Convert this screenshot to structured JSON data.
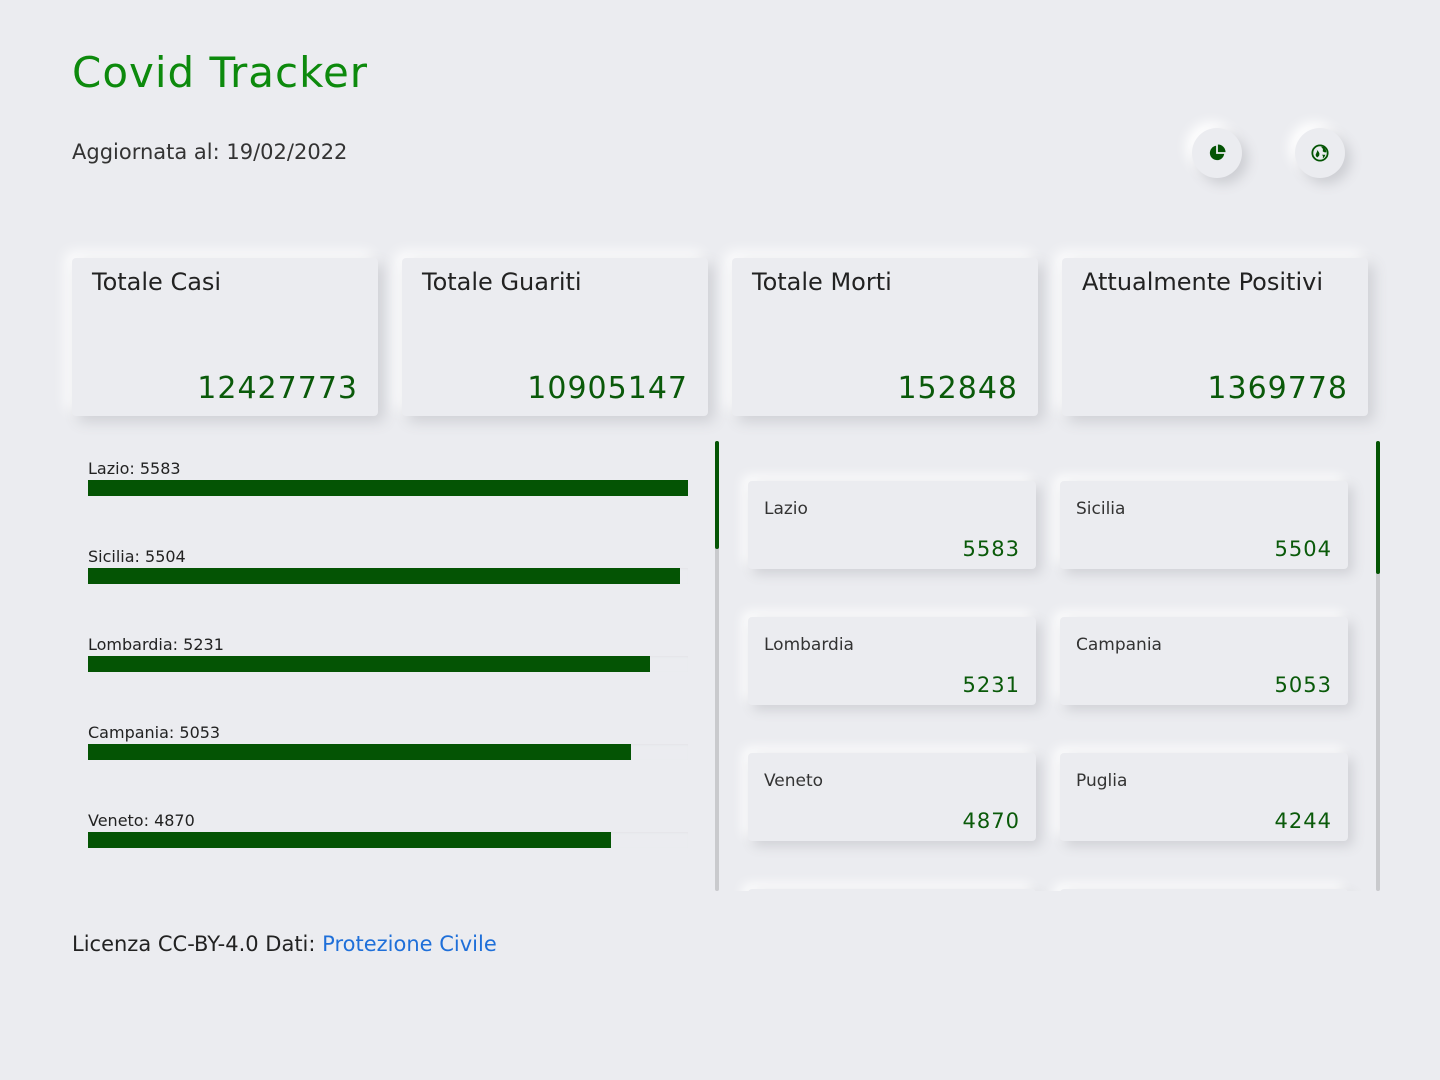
{
  "header": {
    "title": "Covid Tracker",
    "updated_label": "Aggiornata al: 19/02/2022",
    "buttons": [
      {
        "name": "pie-chart-button",
        "icon": "pie-chart-icon"
      },
      {
        "name": "globe-button",
        "icon": "globe-icon"
      }
    ]
  },
  "stats": [
    {
      "label": "Totale Casi",
      "value": "12427773"
    },
    {
      "label": "Totale Guariti",
      "value": "10905147"
    },
    {
      "label": "Totale Morti",
      "value": "152848"
    },
    {
      "label": "Attualmente Positivi",
      "value": "1369778"
    }
  ],
  "chart_data": {
    "type": "bar",
    "orientation": "horizontal",
    "categories": [
      "Lazio",
      "Sicilia",
      "Lombardia",
      "Campania",
      "Veneto"
    ],
    "values": [
      5583,
      5504,
      5231,
      5053,
      4870
    ],
    "labels": [
      "Lazio: 5583",
      "Sicilia: 5504",
      "Lombardia: 5231",
      "Campania: 5053",
      "Veneto: 4870"
    ],
    "xlim": [
      0,
      5583
    ],
    "color": "#045404"
  },
  "regions": [
    {
      "name": "Lazio",
      "value": "5583"
    },
    {
      "name": "Sicilia",
      "value": "5504"
    },
    {
      "name": "Lombardia",
      "value": "5231"
    },
    {
      "name": "Campania",
      "value": "5053"
    },
    {
      "name": "Veneto",
      "value": "4870"
    },
    {
      "name": "Puglia",
      "value": "4244"
    }
  ],
  "footer": {
    "license_text": "Licenza CC-BY-4.0 Dati:",
    "source_link": "Protezione Civile"
  },
  "colors": {
    "background": "#ebecf0",
    "accent_title": "#0d8a0d",
    "accent_dark": "#045404",
    "link": "#1e6fd9"
  }
}
